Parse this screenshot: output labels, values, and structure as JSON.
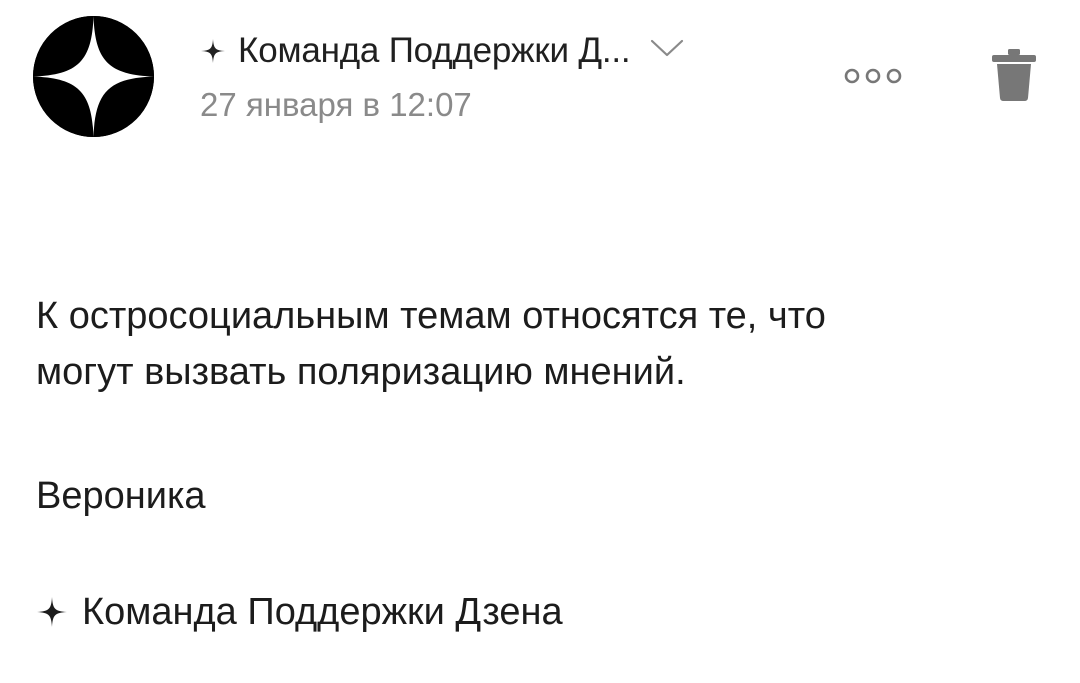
{
  "header": {
    "sender_name": "Команда Поддержки Д...",
    "date": "27 января в 12:07",
    "avatar_icon": "zen-star-logo-icon",
    "expand_icon": "chevron-down-icon",
    "more_icon": "more-dots-icon",
    "delete_icon": "trash-icon"
  },
  "message": {
    "body_line1": "К остросоциальным темам относятся те, что",
    "body_line2": "могут вызвать поляризацию мнений.",
    "signature_name": "Вероника",
    "signature_team": "Команда Поддержки Дзена",
    "signature_icon": "zen-star-icon"
  },
  "colors": {
    "background": "#ffffff",
    "text_primary": "#1c1c1c",
    "text_secondary": "#8a8a8a",
    "icon_gray": "#7a7a7a",
    "avatar_bg": "#000000"
  }
}
